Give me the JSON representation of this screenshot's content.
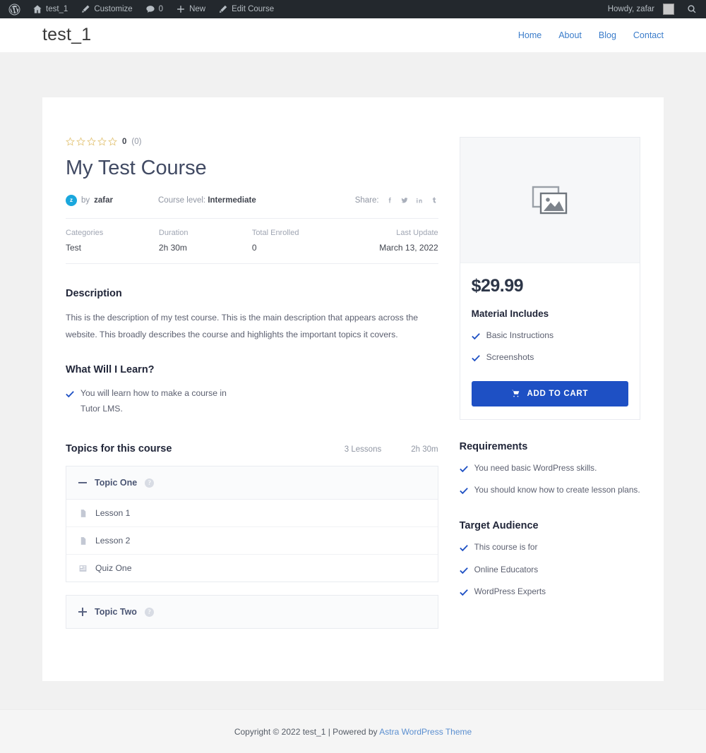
{
  "adminbar": {
    "logo_icon": "wordpress-logo-icon",
    "site_name": "test_1",
    "customize": "Customize",
    "comment_count": "0",
    "new": "New",
    "edit_course": "Edit Course",
    "howdy": "Howdy, zafar",
    "search_icon": "search-icon"
  },
  "header": {
    "site_title": "test_1",
    "nav": [
      {
        "label": "Home"
      },
      {
        "label": "About"
      },
      {
        "label": "Blog"
      },
      {
        "label": "Contact"
      }
    ]
  },
  "course": {
    "rating_value": "0",
    "rating_count": "(0)",
    "stars_total": 5,
    "stars_filled": 0,
    "title": "My Test Course",
    "author_prefix": "by",
    "author": "zafar",
    "author_initial": "z",
    "level_label": "Course level:",
    "level_value": "Intermediate",
    "share_label": "Share:",
    "share_networks": [
      {
        "name": "facebook-icon"
      },
      {
        "name": "twitter-icon"
      },
      {
        "name": "linkedin-icon"
      },
      {
        "name": "tumblr-icon"
      }
    ],
    "info": [
      {
        "label": "Categories",
        "value": "Test"
      },
      {
        "label": "Duration",
        "value": "2h 30m"
      },
      {
        "label": "Total Enrolled",
        "value": "0"
      },
      {
        "label": "Last Update",
        "value": "March 13, 2022"
      }
    ],
    "description_title": "Description",
    "description_body": "This is the description of my test course. This is the main description that appears across the website. This broadly describes the course and highlights the important topics it covers.",
    "learn_title": "What Will I Learn?",
    "learn_items": [
      "You will learn how to make a course in Tutor LMS."
    ],
    "topics_title": "Topics for this course",
    "topics_lessons": "3 Lessons",
    "topics_duration": "2h 30m",
    "topics": [
      {
        "name": "Topic One",
        "expanded": true,
        "toggle_icon": "minus-icon",
        "info_icon": "info-icon",
        "lessons": [
          {
            "name": "Lesson 1",
            "icon": "lesson-document-icon"
          },
          {
            "name": "Lesson 2",
            "icon": "lesson-document-icon"
          },
          {
            "name": "Quiz One",
            "icon": "quiz-icon"
          }
        ]
      },
      {
        "name": "Topic Two",
        "expanded": false,
        "toggle_icon": "plus-icon",
        "info_icon": "info-icon",
        "lessons": []
      }
    ]
  },
  "sidebar": {
    "thumbnail_icon": "image-placeholder-icon",
    "price": "$29.99",
    "material_title": "Material Includes",
    "material_items": [
      "Basic Instructions",
      "Screenshots"
    ],
    "cart_icon": "shopping-cart-icon",
    "cart_label": "ADD TO CART",
    "requirements_title": "Requirements",
    "requirements_items": [
      "You need basic WordPress skills.",
      "You should know how to create lesson plans."
    ],
    "audience_title": "Target Audience",
    "audience_items": [
      "This course is for",
      "Online Educators",
      "WordPress Experts"
    ]
  },
  "footer": {
    "copyright": "Copyright © 2022 test_1 | Powered by ",
    "theme_link": "Astra WordPress Theme"
  },
  "colors": {
    "accent": "#1e50c4",
    "link": "#3a7cca",
    "admin_bar": "#23282d",
    "star": "#e4c77e",
    "page_bg": "#f1f1f1"
  }
}
